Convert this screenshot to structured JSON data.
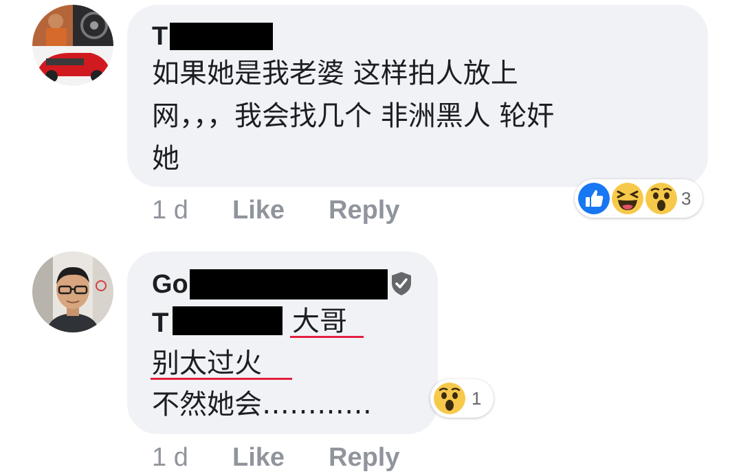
{
  "comments": [
    {
      "author_visible": "T",
      "lines": [
        "如果她是我老婆 这样拍人放上",
        "网，，，我会找几个 非洲黑人 轮奸",
        "她"
      ],
      "time": "1 d",
      "like_label": "Like",
      "reply_label": "Reply",
      "reactions": [
        "like-icon",
        "haha-icon",
        "wow-icon"
      ],
      "reaction_count": "3"
    },
    {
      "author_visible": "Go",
      "verified_icon": "shield-check-icon",
      "mention_visible": "T",
      "mention_suffix": "大哥",
      "lines": [
        "别太过火",
        "不然她会…………"
      ],
      "time": "1 d",
      "like_label": "Like",
      "reply_label": "Reply",
      "reactions": [
        "wow-icon"
      ],
      "reaction_count": "1"
    }
  ],
  "colors": {
    "bubble": "#f0f2f5",
    "meta_text": "#90949c",
    "underline": "#e41e3f",
    "like_blue": "#1877f2",
    "reaction_yellow": "#f7c94a"
  }
}
